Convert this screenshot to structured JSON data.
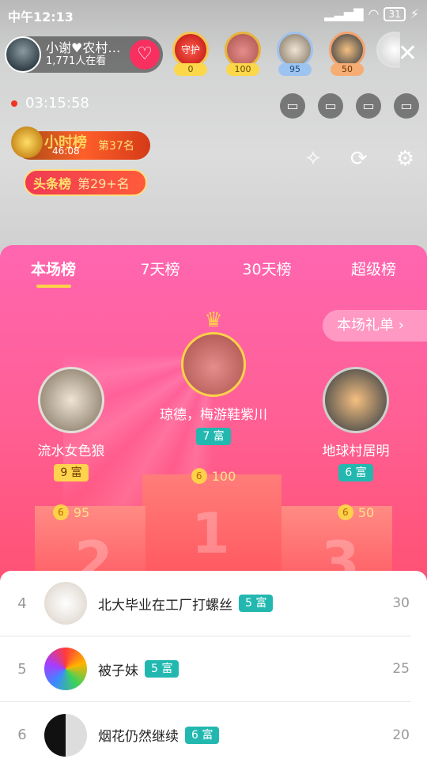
{
  "status": {
    "time": "中午12:13",
    "battery": "31"
  },
  "host": {
    "name": "小谢♥农村…",
    "viewers": "1,771人在看"
  },
  "top_fans": [
    {
      "label": "守护",
      "value": "0"
    },
    {
      "value": "100"
    },
    {
      "value": "95"
    },
    {
      "value": "50"
    }
  ],
  "live_timer": "03:15:58",
  "hour_rank": {
    "title": "小时榜",
    "time": "46:08",
    "position": "第37名"
  },
  "headline_rank": {
    "title": "头条榜",
    "position": "第29+名"
  },
  "tabs": [
    "本场榜",
    "7天榜",
    "30天榜",
    "超级榜"
  ],
  "gift_list_label": "本场礼单",
  "podium": {
    "first": {
      "name": "琼德，梅游鞋紫川",
      "rich": "7 富",
      "coins": "100",
      "rank": "1"
    },
    "second": {
      "name": "流水女色狼",
      "rich": "9 富",
      "coins": "95",
      "rank": "2"
    },
    "third": {
      "name": "地球村居明",
      "rich": "6 富",
      "coins": "50",
      "rank": "3"
    }
  },
  "list": [
    {
      "rank": "4",
      "name": "北大毕业在工厂打螺丝",
      "rich": "5 富",
      "score": "30"
    },
    {
      "rank": "5",
      "name": "被子妹",
      "rich": "5 富",
      "score": "25"
    },
    {
      "rank": "6",
      "name": "烟花仍然继续",
      "rich": "6 富",
      "score": "20"
    }
  ]
}
